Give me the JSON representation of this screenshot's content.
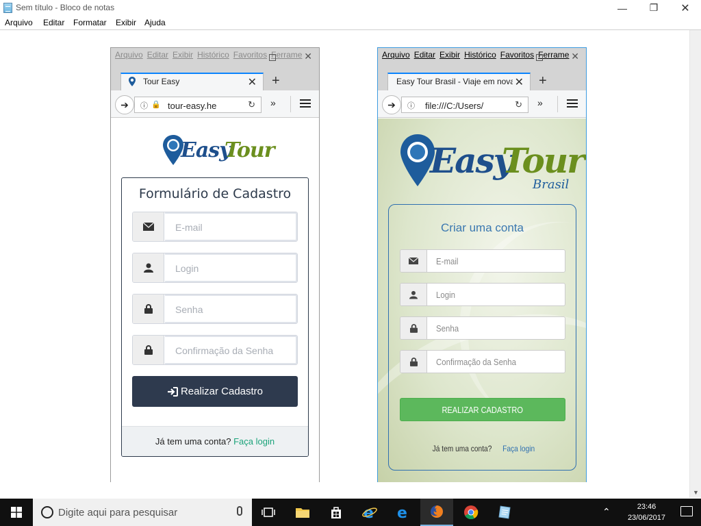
{
  "notepad": {
    "title": "Sem título - Bloco de notas",
    "menu": [
      "Arquivo",
      "Editar",
      "Formatar",
      "Exibir",
      "Ajuda"
    ]
  },
  "browser_left": {
    "menu": [
      "Arquivo",
      "Editar",
      "Exibir",
      "Histórico",
      "Favoritos",
      "Ferrame"
    ],
    "tab_title": "Tour Easy",
    "url": "tour-easy.he",
    "logo": {
      "word1": "Easy",
      "word2": "Tour"
    },
    "form": {
      "title": "Formulário de Cadastro",
      "fields": [
        {
          "icon": "envelope-icon",
          "placeholder": "E-mail"
        },
        {
          "icon": "user-icon",
          "placeholder": "Login"
        },
        {
          "icon": "lock-icon",
          "placeholder": "Senha"
        },
        {
          "icon": "lock-icon",
          "placeholder": "Confirmação da Senha"
        }
      ],
      "submit_label": "Realizar Cadastro",
      "footer_text": "Já tem uma conta?",
      "footer_link": "Faça login"
    }
  },
  "browser_right": {
    "menu": [
      "Arquivo",
      "Editar",
      "Exibir",
      "Histórico",
      "Favoritos",
      "Ferrame"
    ],
    "tab_title": "Easy Tour Brasil - Viaje em novas",
    "url": "file:///C:/Users/",
    "logo": {
      "word1": "Easy",
      "word2": "Tour",
      "word3": "Brasil"
    },
    "form": {
      "title": "Criar uma conta",
      "fields": [
        {
          "icon": "envelope-icon",
          "placeholder": "E-mail"
        },
        {
          "icon": "user-icon",
          "placeholder": "Login"
        },
        {
          "icon": "lock-icon",
          "placeholder": "Senha"
        },
        {
          "icon": "lock-icon",
          "placeholder": "Confirmação da Senha"
        }
      ],
      "submit_label": "REALIZAR CADASTRO",
      "footer_text": "Já tem uma conta?",
      "footer_link": "Faça login"
    }
  },
  "taskbar": {
    "search_placeholder": "Digite aqui para pesquisar",
    "time": "23:46",
    "date": "23/06/2017"
  }
}
